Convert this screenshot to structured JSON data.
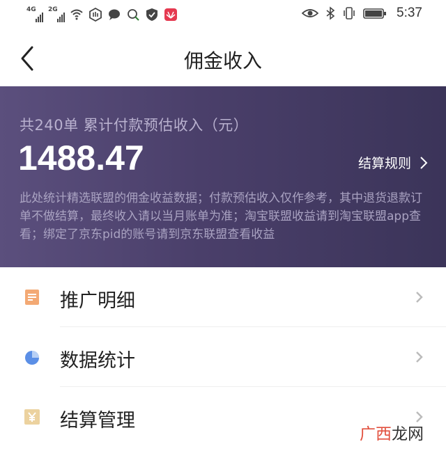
{
  "status_bar": {
    "sig1": "4G",
    "sig2": "2G",
    "time": "5:37"
  },
  "header": {
    "title": "佣金收入"
  },
  "banner": {
    "summary": "共240单 累计付款预估收入（元）",
    "amount": "1488.47",
    "rules_label": "结算规则",
    "notice": "此处统计精选联盟的佣金收益数据；付款预估收入仅作参考，其中退货退款订单不做结算，最终收入请以当月账单为准；淘宝联盟收益请到淘宝联盟app查看；绑定了京东pid的账号请到京东联盟查看收益"
  },
  "menu": {
    "items": [
      {
        "label": "推广明细",
        "icon": "document-icon",
        "color": "#f0a46c"
      },
      {
        "label": "数据统计",
        "icon": "pie-chart-icon",
        "color": "#5a8fe6"
      },
      {
        "label": "结算管理",
        "icon": "yen-icon",
        "color": "#e8c88a"
      }
    ]
  },
  "watermark": {
    "part1": "广西",
    "part2": "龙网"
  }
}
